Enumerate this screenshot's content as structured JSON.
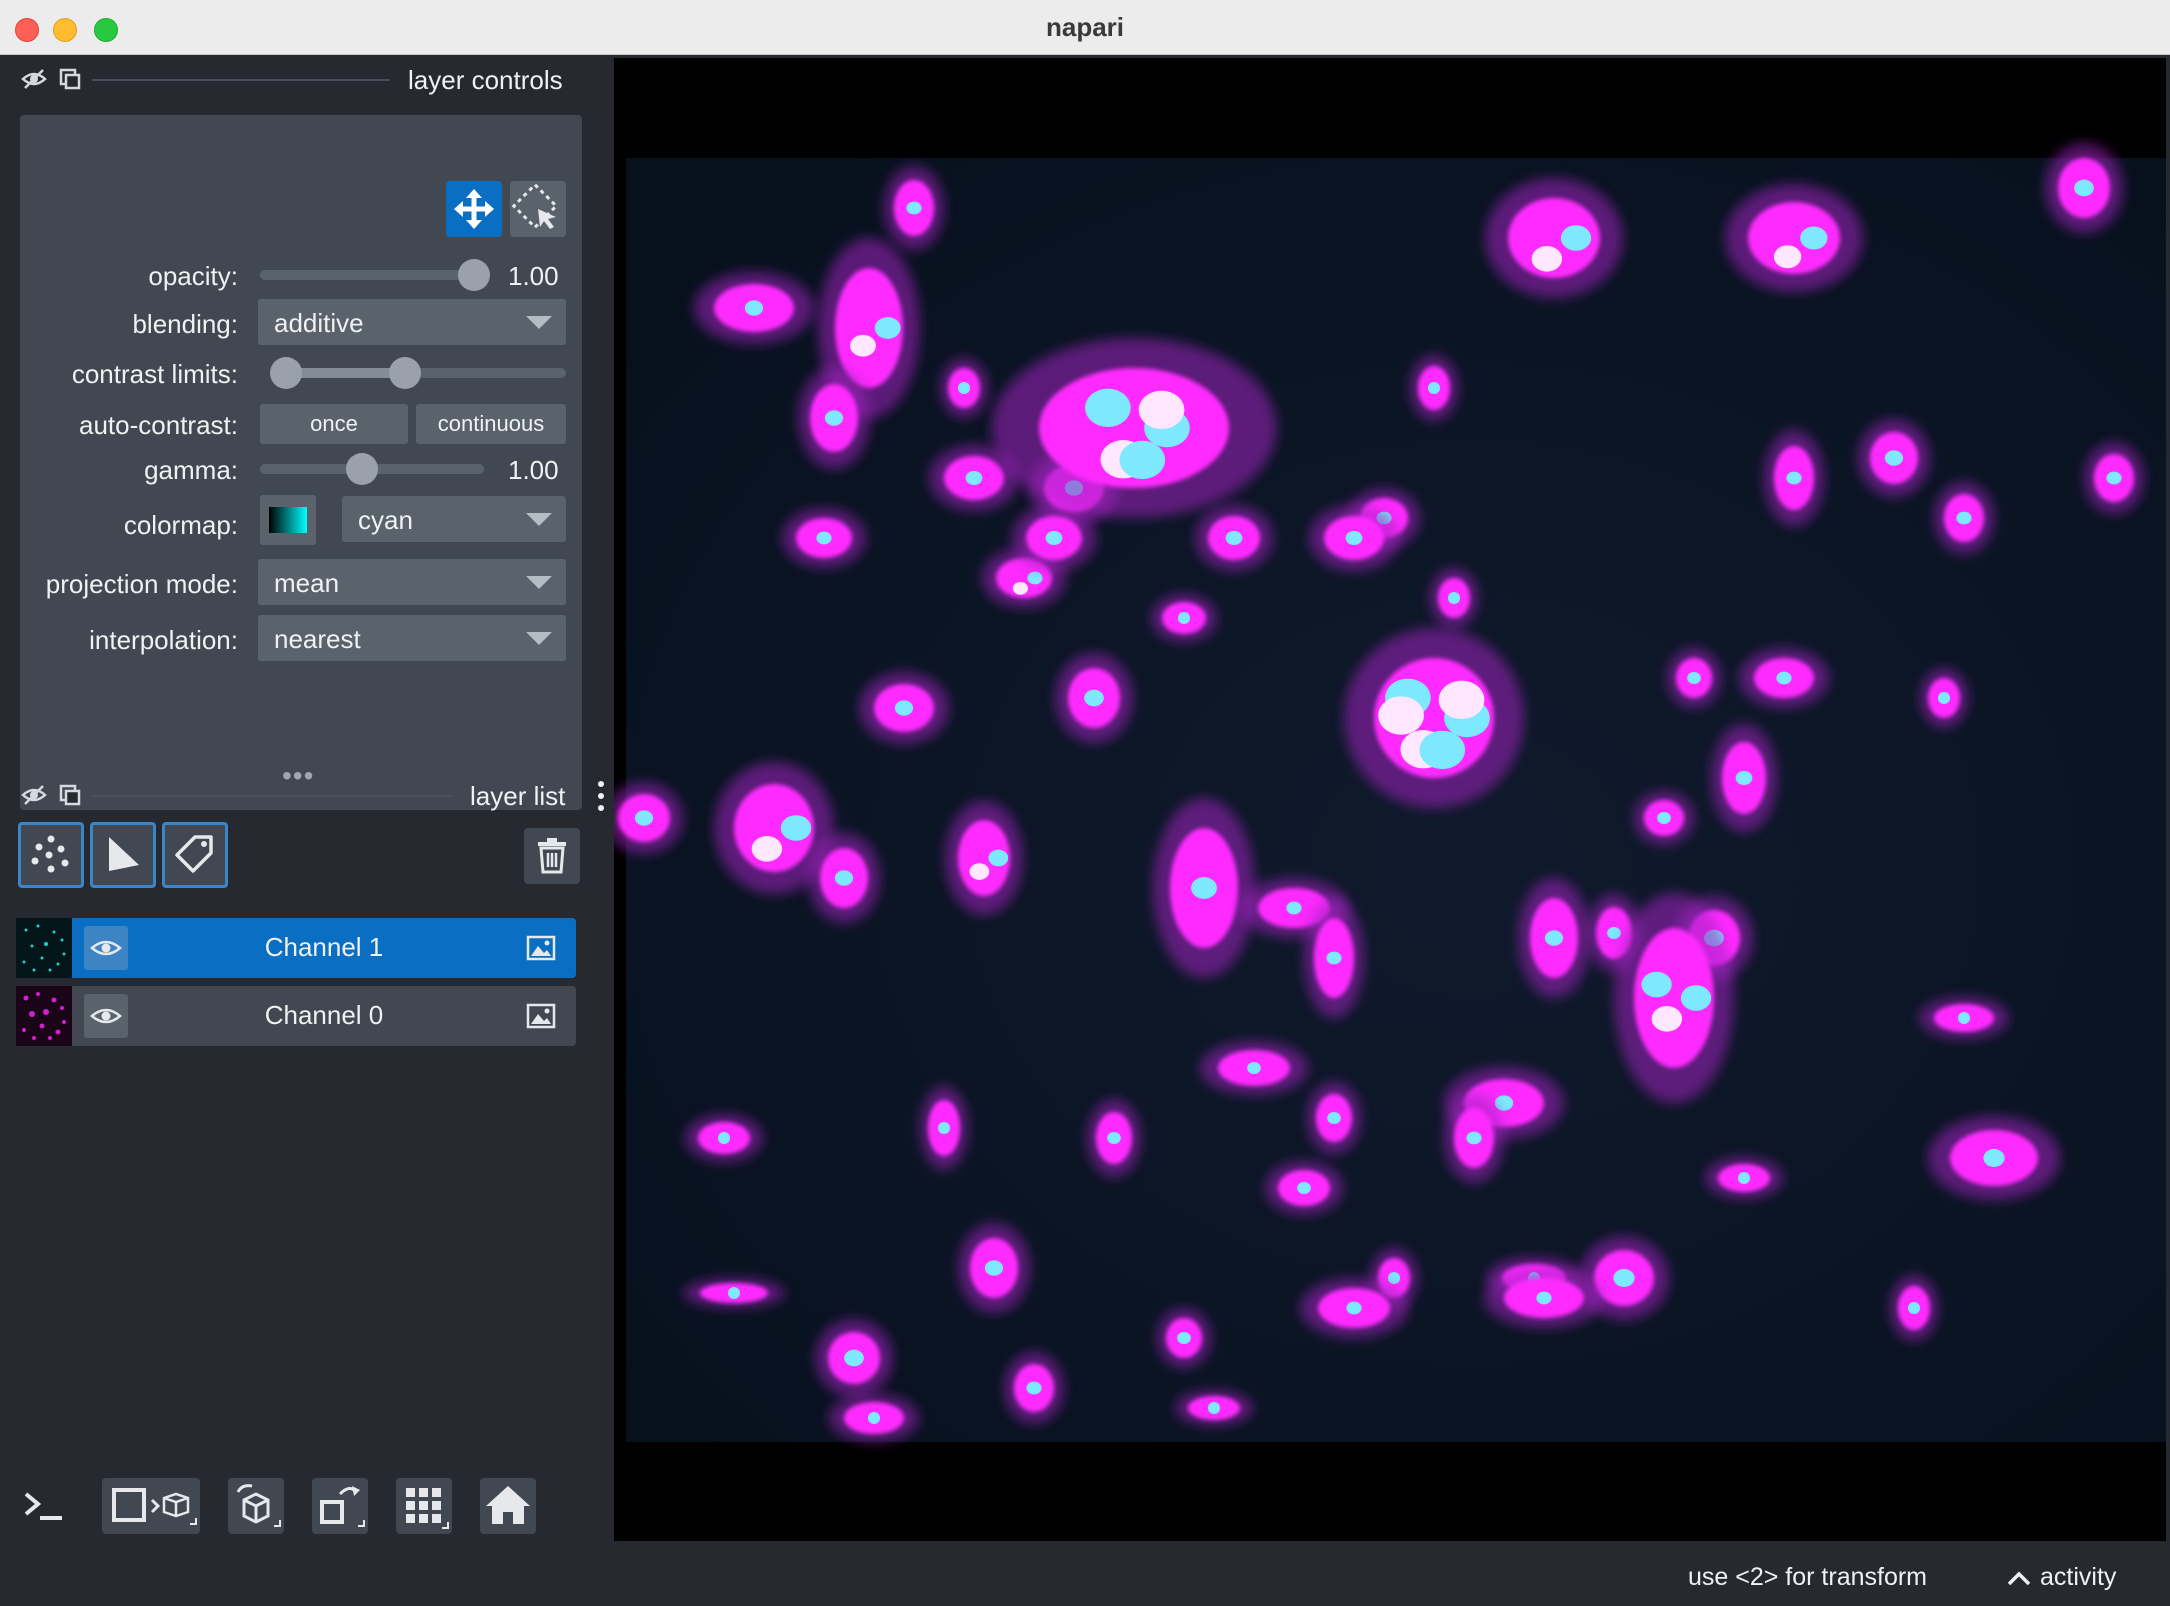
{
  "window": {
    "title": "napari"
  },
  "layer_controls": {
    "title": "layer controls",
    "opacity": {
      "label": "opacity:",
      "value": "1.00",
      "level": 1.0
    },
    "blending": {
      "label": "blending:",
      "value": "additive"
    },
    "contrast_limits": {
      "label": "contrast limits:",
      "low": 0.0,
      "high": 0.45
    },
    "auto_contrast": {
      "label": "auto-contrast:",
      "once": "once",
      "continuous": "continuous"
    },
    "gamma": {
      "label": "gamma:",
      "value": "1.00",
      "level": 0.45
    },
    "colormap": {
      "label": "colormap:",
      "value": "cyan"
    },
    "projection_mode": {
      "label": "projection mode:",
      "value": "mean"
    },
    "interpolation": {
      "label": "interpolation:",
      "value": "nearest"
    }
  },
  "layer_list": {
    "title": "layer list",
    "layers": [
      {
        "name": "Channel 1",
        "selected": true
      },
      {
        "name": "Channel 0",
        "selected": false
      }
    ]
  },
  "bottom_toolbar": [
    "console-icon",
    "ndisplay-toggle-icon",
    "roll-dims-icon",
    "transpose-icon",
    "grid-icon",
    "home-icon"
  ],
  "status_bar": {
    "hint": "use <2> for transform",
    "activity": "activity"
  },
  "colors": {
    "accent": "#0a6fc2",
    "panel": "#414851",
    "background": "#262930",
    "magenta": "#ff00ff",
    "cyan": "#00ffff"
  }
}
